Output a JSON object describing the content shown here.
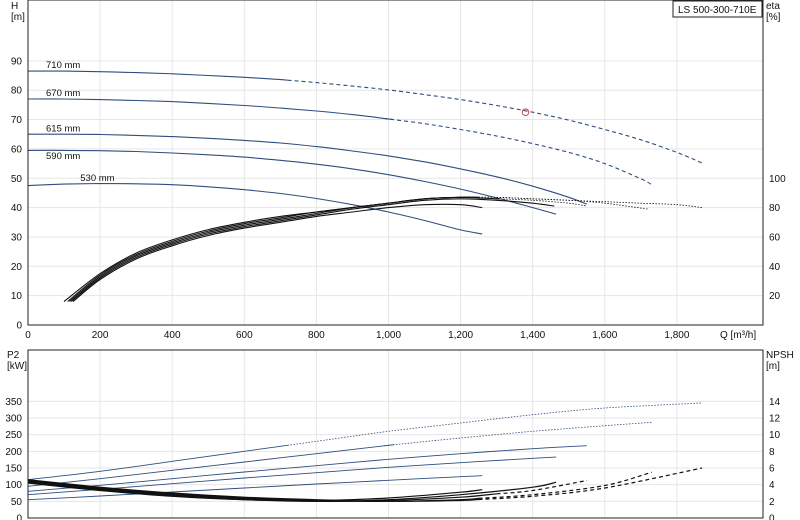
{
  "chart_data": [
    {
      "type": "line",
      "title": "LS 500-300-710E",
      "xlabel": "Q [m³/h]",
      "ylabel": "H\n[m]",
      "ylabel2": "eta\n[%]",
      "xlim": [
        0,
        2000
      ],
      "ylim": [
        0,
        100
      ],
      "ylim2": [
        0,
        150
      ],
      "xticks": [
        0,
        200,
        400,
        600,
        800,
        1000,
        1200,
        1400,
        1600,
        1800
      ],
      "xtick_labels": [
        "0",
        "200",
        "400",
        "600",
        "800",
        "1,000",
        "1,200",
        "1,400",
        "1,600",
        "1,800"
      ],
      "yticks": [
        0,
        10,
        20,
        30,
        40,
        50,
        60,
        70,
        80,
        90
      ],
      "yticks2": [
        20,
        40,
        60,
        80,
        100
      ],
      "grid": true,
      "head_curves": [
        {
          "name": "710 mm",
          "x": [
            0,
            100,
            200,
            300,
            400,
            500,
            600,
            700,
            800,
            900,
            1000,
            1100,
            1200,
            1300,
            1400,
            1500,
            1600,
            1700,
            1800,
            1870
          ],
          "y": [
            86.5,
            86.5,
            86.3,
            86.0,
            85.6,
            85.0,
            84.4,
            83.6,
            82.6,
            81.4,
            80.1,
            78.5,
            76.8,
            74.8,
            72.5,
            69.8,
            66.6,
            63.1,
            58.8,
            55.2
          ],
          "dashed_from": 720
        },
        {
          "name": "670 mm",
          "x": [
            0,
            100,
            200,
            300,
            400,
            500,
            600,
            700,
            800,
            900,
            1000,
            1100,
            1200,
            1300,
            1400,
            1500,
            1600,
            1700,
            1730
          ],
          "y": [
            77.0,
            77.0,
            76.8,
            76.5,
            76.1,
            75.5,
            74.8,
            73.9,
            72.9,
            71.7,
            70.2,
            68.6,
            66.6,
            64.4,
            61.8,
            58.8,
            55.0,
            49.8,
            47.8
          ],
          "dashed_from": 1000
        },
        {
          "name": "615 mm",
          "x": [
            0,
            100,
            200,
            300,
            400,
            500,
            600,
            700,
            800,
            900,
            1000,
            1100,
            1200,
            1300,
            1400,
            1500,
            1550
          ],
          "y": [
            65.0,
            65.0,
            64.9,
            64.6,
            64.2,
            63.6,
            62.9,
            62.0,
            60.8,
            59.3,
            57.6,
            55.6,
            53.2,
            50.5,
            47.3,
            43.5,
            41.2
          ],
          "dashed_from": 9999
        },
        {
          "name": "590 mm",
          "x": [
            0,
            100,
            200,
            300,
            400,
            500,
            600,
            700,
            800,
            900,
            1000,
            1100,
            1200,
            1300,
            1400,
            1465
          ],
          "y": [
            59.5,
            59.5,
            59.4,
            59.1,
            58.6,
            58.0,
            57.2,
            56.1,
            54.8,
            53.2,
            51.2,
            48.9,
            46.3,
            43.3,
            40.0,
            37.8
          ],
          "dashed_from": 9999
        },
        {
          "name": "530 mm",
          "x": [
            0,
            100,
            200,
            300,
            400,
            500,
            600,
            700,
            800,
            900,
            1000,
            1100,
            1200,
            1260
          ],
          "y": [
            47.5,
            48.0,
            48.2,
            48.1,
            47.8,
            47.1,
            46.1,
            44.8,
            43.1,
            41.0,
            38.5,
            35.6,
            32.4,
            31.0
          ],
          "dashed_from": 9999
        }
      ],
      "efficiency_curves": [
        {
          "x": [
            100,
            200,
            300,
            400,
            500,
            600,
            700,
            800,
            900,
            1000,
            1100,
            1200,
            1300,
            1400,
            1500,
            1600,
            1700,
            1800,
            1870
          ],
          "y": [
            16,
            35,
            49,
            58,
            65,
            70,
            74,
            77,
            80,
            83,
            86,
            87,
            87,
            86,
            85,
            84,
            83,
            82,
            80
          ],
          "dashed_from": 1250
        },
        {
          "x": [
            110,
            200,
            300,
            400,
            500,
            600,
            700,
            800,
            900,
            1000,
            1100,
            1200,
            1300,
            1400,
            1500,
            1600,
            1720
          ],
          "y": [
            16,
            34,
            48,
            57,
            64,
            69,
            73,
            77,
            80,
            83,
            86,
            87,
            87,
            86,
            85,
            83,
            79
          ],
          "dashed_from": 1250
        },
        {
          "x": [
            115,
            200,
            300,
            400,
            500,
            600,
            700,
            800,
            900,
            1000,
            1100,
            1200,
            1300,
            1400,
            1500,
            1550
          ],
          "y": [
            16,
            33,
            47,
            56,
            63,
            68,
            72,
            76,
            80,
            83,
            86,
            87,
            86,
            85,
            83,
            81
          ],
          "dashed_from": 1300
        },
        {
          "x": [
            120,
            200,
            300,
            400,
            500,
            600,
            700,
            800,
            900,
            1000,
            1100,
            1200,
            1300,
            1400,
            1460
          ],
          "y": [
            16,
            32,
            46,
            55,
            62,
            67,
            71,
            75,
            79,
            82,
            85,
            86,
            85,
            83,
            81
          ],
          "dashed_from": 9999
        },
        {
          "x": [
            125,
            200,
            300,
            400,
            500,
            600,
            700,
            800,
            900,
            1000,
            1100,
            1200,
            1260
          ],
          "y": [
            16,
            31,
            45,
            54,
            61,
            66,
            70,
            74,
            77,
            80,
            82,
            82,
            80
          ],
          "dashed_from": 9999
        }
      ],
      "operating_point": {
        "x": 1380,
        "y": 72.5
      },
      "curve_labels": [
        {
          "text": "710 mm",
          "x": 50,
          "y": 87.5
        },
        {
          "text": "670 mm",
          "x": 50,
          "y": 78.0
        },
        {
          "text": "615 mm",
          "x": 50,
          "y": 66.0
        },
        {
          "text": "590 mm",
          "x": 50,
          "y": 56.5
        },
        {
          "text": "530 mm",
          "x": 145,
          "y": 49.0
        }
      ]
    },
    {
      "type": "line",
      "xlim": [
        0,
        2000
      ],
      "ylim": [
        0,
        400
      ],
      "ylim2": [
        0,
        16
      ],
      "ylabel": "P2\n[kW]",
      "ylabel2": "NPSH\n[m]",
      "yticks": [
        0,
        50,
        100,
        150,
        200,
        250,
        300,
        350
      ],
      "yticks2": [
        0,
        2,
        4,
        6,
        8,
        10,
        12,
        14
      ],
      "grid": true,
      "power_curves": [
        {
          "x": [
            0,
            200,
            400,
            600,
            800,
            1000,
            1200,
            1400,
            1600,
            1870
          ],
          "y": [
            115,
            140,
            170,
            200,
            230,
            260,
            285,
            310,
            330,
            345
          ],
          "dashed_from": 720
        },
        {
          "x": [
            0,
            200,
            400,
            600,
            800,
            1000,
            1200,
            1400,
            1600,
            1730
          ],
          "y": [
            95,
            118,
            143,
            168,
            193,
            218,
            240,
            260,
            277,
            287
          ],
          "dashed_from": 1000
        },
        {
          "x": [
            0,
            200,
            400,
            600,
            800,
            1000,
            1200,
            1400,
            1550
          ],
          "y": [
            80,
            98,
            118,
            138,
            157,
            176,
            193,
            208,
            217
          ],
          "dashed_from": 9999
        },
        {
          "x": [
            0,
            200,
            400,
            600,
            800,
            1000,
            1200,
            1400,
            1465
          ],
          "y": [
            70,
            86,
            103,
            120,
            136,
            152,
            166,
            179,
            183
          ],
          "dashed_from": 9999
        },
        {
          "x": [
            0,
            200,
            400,
            600,
            800,
            1000,
            1200,
            1260
          ],
          "y": [
            55,
            66,
            78,
            90,
            102,
            113,
            124,
            127
          ],
          "dashed_from": 9999
        }
      ],
      "npsh_curves": [
        {
          "x": [
            0,
            200,
            400,
            600,
            800,
            1000,
            1200,
            1400,
            1600,
            1870
          ],
          "y": [
            4.6,
            3.7,
            3.0,
            2.5,
            2.2,
            2.0,
            2.1,
            2.6,
            3.6,
            6.0
          ],
          "dashed_from": 1250
        },
        {
          "x": [
            0,
            200,
            400,
            600,
            800,
            1000,
            1200,
            1400,
            1600,
            1730
          ],
          "y": [
            4.5,
            3.6,
            2.9,
            2.4,
            2.1,
            2.0,
            2.2,
            2.8,
            3.9,
            5.5
          ],
          "dashed_from": 1250
        },
        {
          "x": [
            0,
            200,
            400,
            600,
            800,
            1000,
            1200,
            1400,
            1550
          ],
          "y": [
            4.4,
            3.5,
            2.8,
            2.3,
            2.0,
            2.1,
            2.5,
            3.3,
            4.5
          ],
          "dashed_from": 1300
        },
        {
          "x": [
            0,
            200,
            400,
            600,
            800,
            1000,
            1200,
            1400,
            1465
          ],
          "y": [
            4.3,
            3.4,
            2.7,
            2.2,
            2.0,
            2.2,
            2.8,
            3.7,
            4.3
          ],
          "dashed_from": 9999
        },
        {
          "x": [
            0,
            200,
            400,
            600,
            800,
            1000,
            1200,
            1260
          ],
          "y": [
            4.2,
            3.3,
            2.6,
            2.2,
            2.1,
            2.4,
            3.1,
            3.4
          ],
          "dashed_from": 9999
        }
      ]
    }
  ]
}
